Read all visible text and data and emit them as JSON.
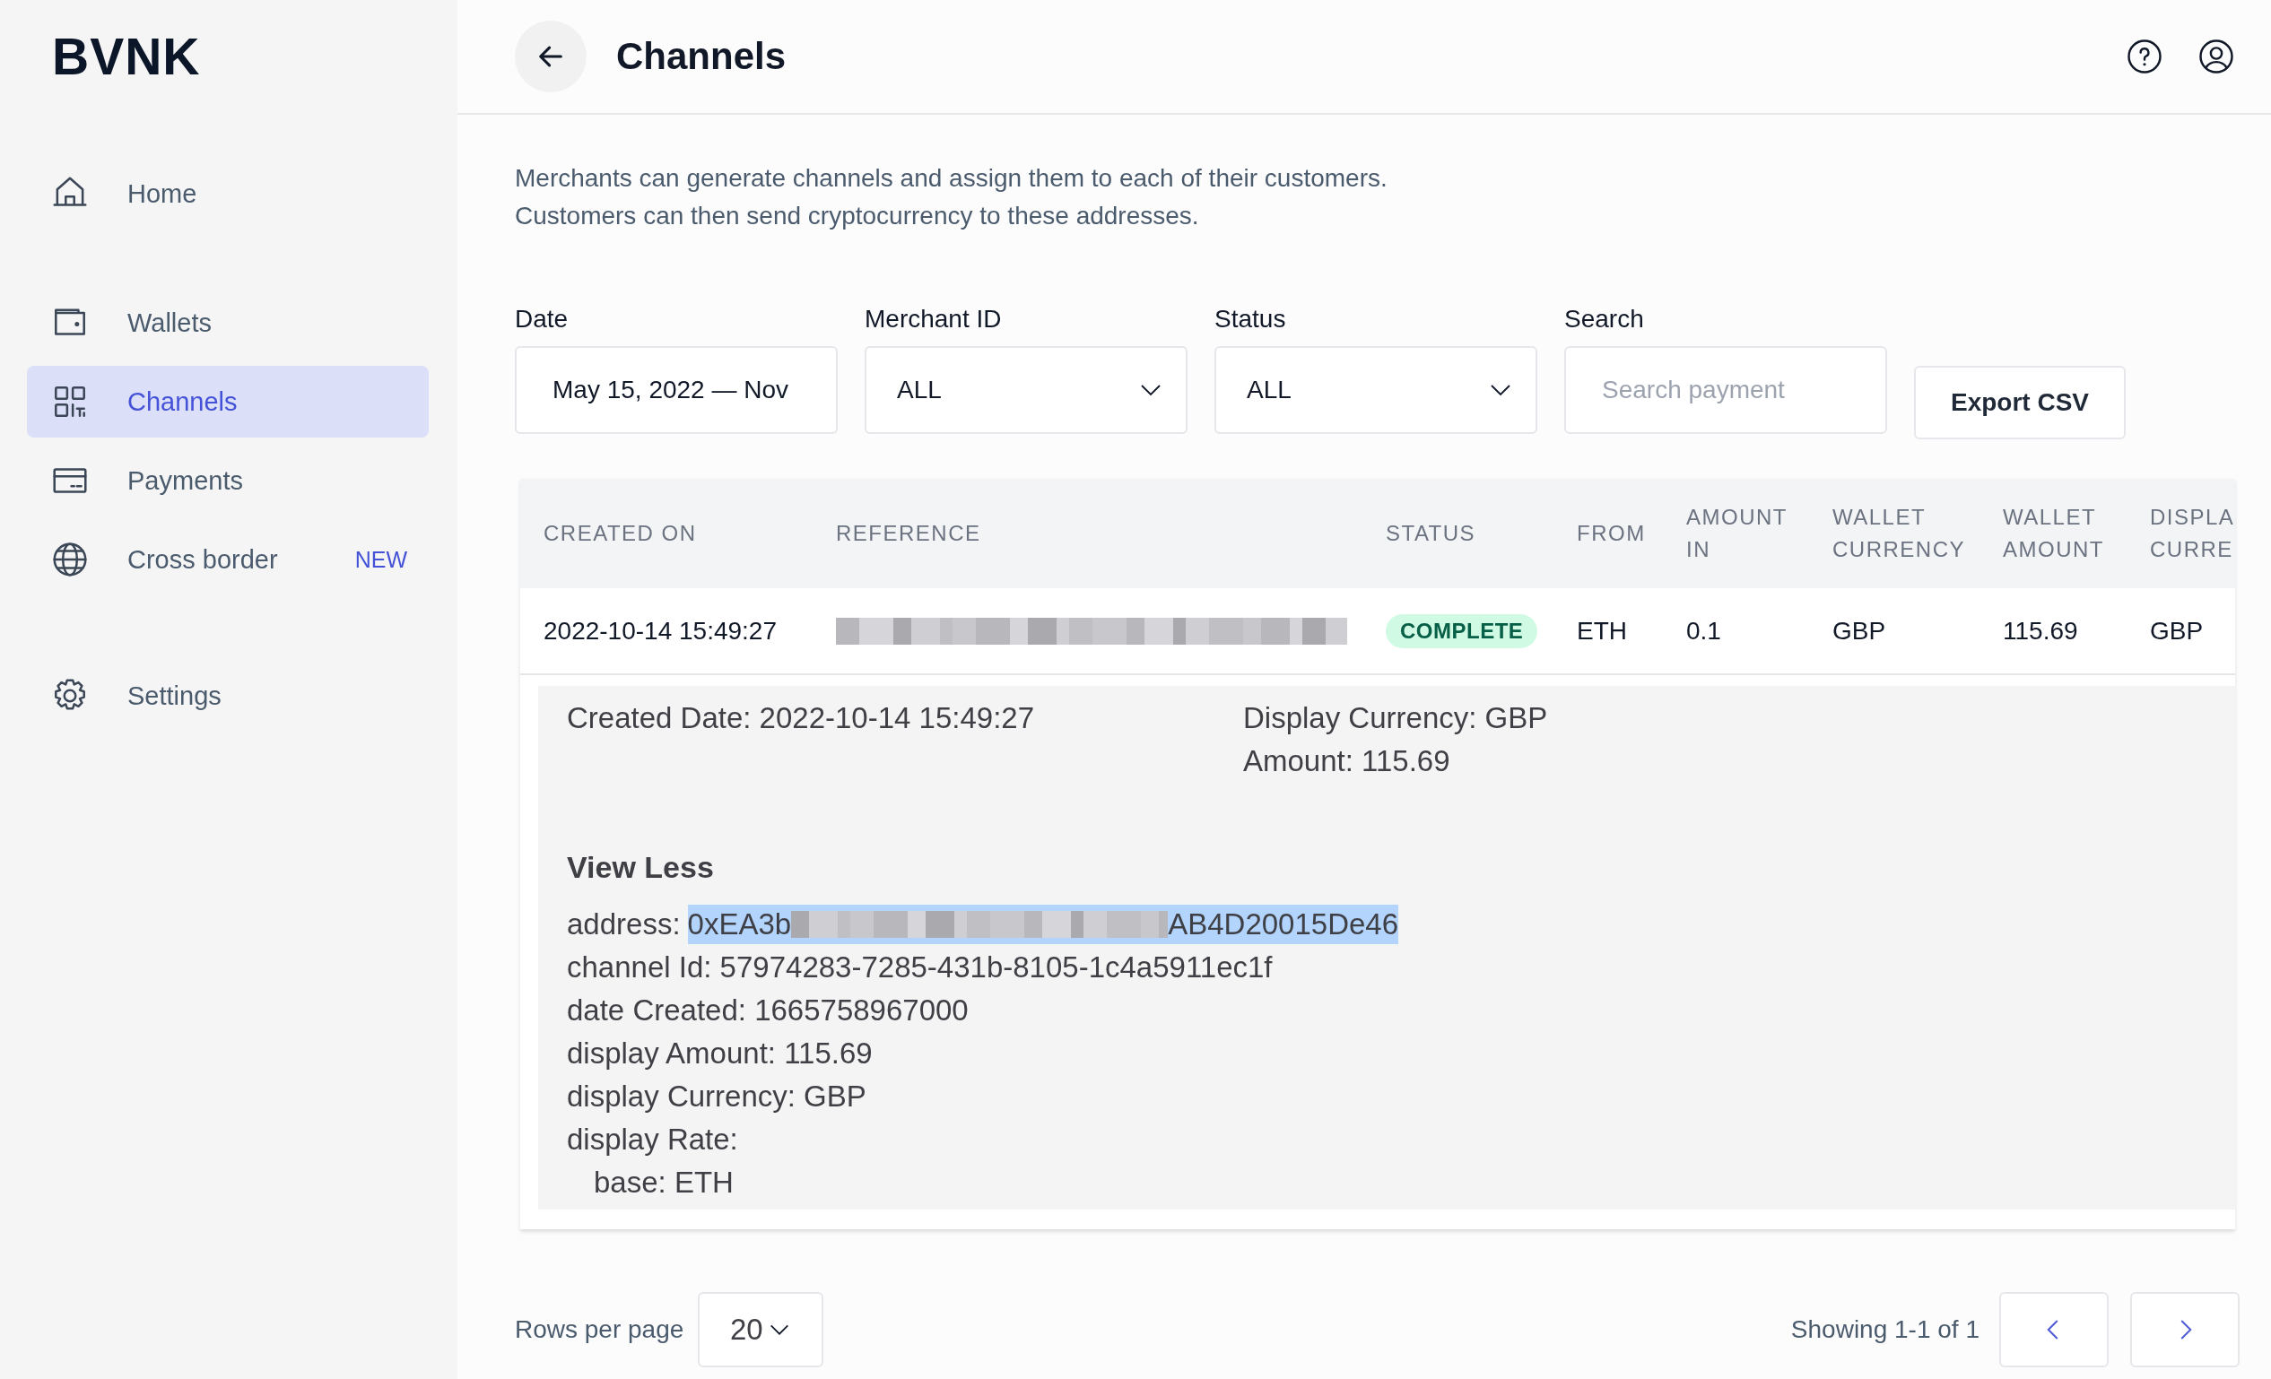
{
  "logo": "BVNK",
  "sidebar": {
    "groups": [
      {
        "items": [
          {
            "label": "Home",
            "kind": "home",
            "selected": false
          }
        ]
      },
      {
        "items": [
          {
            "label": "Wallets",
            "kind": "wallet",
            "selected": false
          },
          {
            "label": "Channels",
            "kind": "qr",
            "selected": true
          },
          {
            "label": "Payments",
            "kind": "card",
            "selected": false
          },
          {
            "label": "Cross border",
            "kind": "globe",
            "selected": false,
            "badge": "NEW"
          }
        ]
      },
      {
        "items": [
          {
            "label": "Settings",
            "kind": "gear",
            "selected": false
          }
        ]
      }
    ]
  },
  "header": {
    "title": "Channels"
  },
  "description": [
    "Merchants can generate channels and assign them to each of their customers.",
    "Customers can then send cryptocurrency to these addresses."
  ],
  "filters": [
    {
      "label": "Date",
      "kind": "text",
      "value": "May 15, 2022 — Nov"
    },
    {
      "label": "Merchant ID",
      "kind": "select",
      "value": "ALL"
    },
    {
      "label": "Status",
      "kind": "select",
      "value": "ALL"
    },
    {
      "label": "Search",
      "kind": "search",
      "placeholder": "Search payment"
    }
  ],
  "export_button": "Export CSV",
  "table": {
    "columns": [
      "CREATED ON",
      "REFERENCE",
      "STATUS",
      "FROM",
      "AMOUNT\nIN",
      "WALLET\nCURRENCY",
      "WALLET\nAMOUNT",
      "DISPLA\nCURRE"
    ],
    "rows": [
      {
        "cells": [
          {
            "kind": "text",
            "text": "2022-10-14 15:49:27"
          },
          {
            "kind": "redacted"
          },
          {
            "kind": "badge",
            "text": "COMPLETE"
          },
          {
            "kind": "text",
            "text": "ETH"
          },
          {
            "kind": "text",
            "text": "0.1"
          },
          {
            "kind": "text",
            "text": "GBP"
          },
          {
            "kind": "text",
            "text": "115.69"
          },
          {
            "kind": "text",
            "text": "GBP"
          }
        ],
        "details": {
          "summary": [
            [
              "Created Date: 2022-10-14 15:49:27"
            ],
            [
              "Display Currency: GBP",
              "Amount: 115.69"
            ]
          ],
          "toggle": "View Less",
          "fields": [
            {
              "kind": "address",
              "label": "address:",
              "start": "0xEA3b",
              "end": "AB4D20015De46",
              "selected": true
            },
            {
              "kind": "line",
              "text": "channel Id: 57974283-7285-431b-8105-1c4a5911ec1f"
            },
            {
              "kind": "line",
              "text": "date Created: 1665758967000"
            },
            {
              "kind": "line",
              "text": "display Amount: 115.69"
            },
            {
              "kind": "line",
              "text": "display Currency: GBP"
            },
            {
              "kind": "line",
              "text": "display Rate:",
              "children": [
                {
                  "kind": "line",
                  "text": "base: ETH"
                }
              ]
            }
          ]
        }
      }
    ]
  },
  "pagination": {
    "rows_label": "Rows per page",
    "rows_value": "20",
    "summary": "Showing 1-1 of 1"
  }
}
